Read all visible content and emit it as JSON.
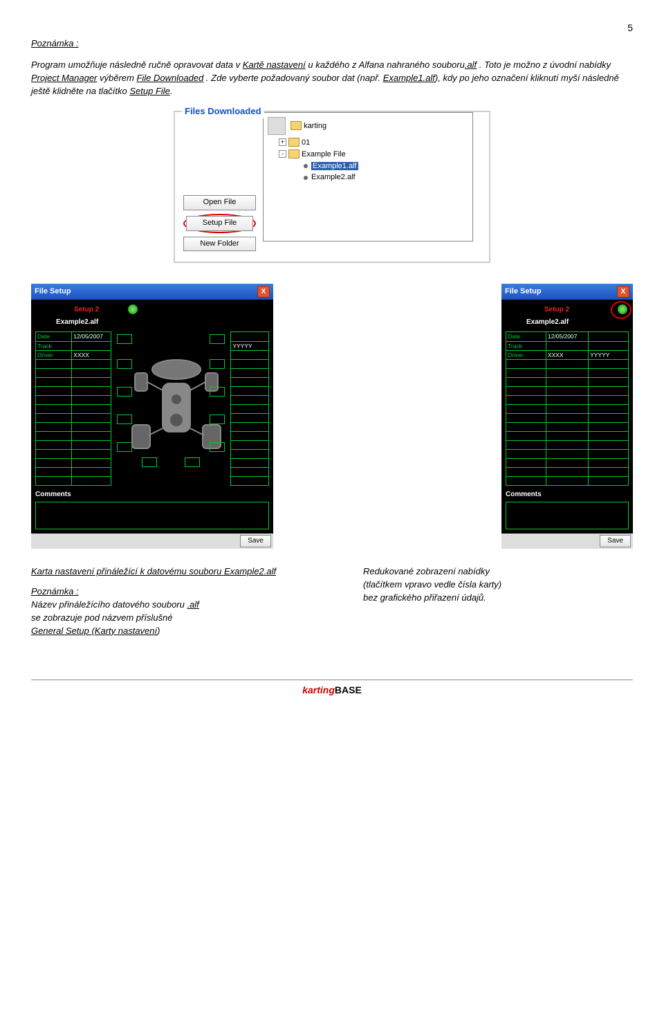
{
  "page_number": "5",
  "p1_note": "Poznámka :",
  "p1a": "Program umožňuje následně ručně opravovat data v ",
  "p1b": "Kartě nastavení",
  "p1c": " u každého z Alfana nahraného souboru",
  "p1d": ".alf",
  "p1e": " . Toto je možno z úvodní nabídky ",
  "p1f": "Project Manager",
  "p1g": " výběrem ",
  "p1h": "File Downloaded",
  "p1i": " . Zde vyberte požadovaný soubor dat (např. ",
  "p1j": "Example1.alf",
  "p1k": "), kdy po jeho označení kliknutí myší následně ještě klidněte na tlačítko ",
  "p1l": "Setup File",
  "p1m": ".",
  "files": {
    "legend": "Files Downloaded",
    "buttons": {
      "open": "Open File",
      "setup": "Setup File",
      "newf": "New Folder"
    },
    "tree": {
      "r0": "karting",
      "r1": "01",
      "r2": "Example File",
      "r3": "Example1.alf",
      "r4": "Example2.alf"
    }
  },
  "setup": {
    "title": "File Setup",
    "hdr": "Setup 2",
    "sub": "Example2.alf",
    "rows": {
      "date_l": "Date",
      "date_v": "12/05/2007",
      "track_l": "Track",
      "track_v": "",
      "driver_l": "Driver",
      "driver_v1": "XXXX",
      "driver_v2": "YYYYY"
    },
    "comments": "Comments",
    "save": "Save"
  },
  "caption": {
    "left1": "Karta nastavení přináležící k datovému souboru ",
    "left1u": "Example2.alf",
    "left2": "Poznámka :",
    "left3a": "Název přináležícího datového souboru ",
    "left3b": ".alf",
    "left4": "se zobrazuje pod názvem příslušné",
    "left5a": "General Setup ",
    "left5b": "(",
    "left5c": "Karty nastavení",
    "left5d": ")",
    "right1": "Redukované zobrazení nabídky",
    "right2": "(tlačítkem vpravo vedle čísla karty)",
    "right3": "bez grafického přiřazení údajů."
  },
  "logo": {
    "a": "karting",
    "b": "BASE"
  }
}
